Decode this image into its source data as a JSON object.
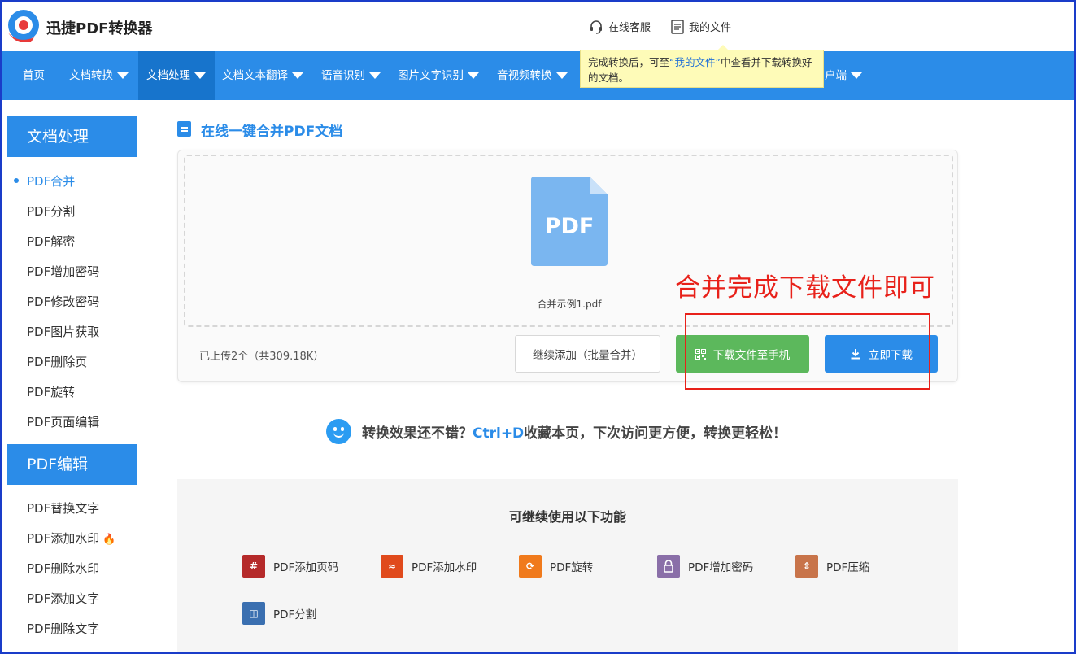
{
  "header": {
    "brand": "迅捷PDF转换器",
    "service_label": "在线客服",
    "files_label": "我的文件"
  },
  "nav": {
    "items": [
      {
        "label": "首页"
      },
      {
        "label": "文档转换"
      },
      {
        "label": "文档处理"
      },
      {
        "label": "文档文本翻译"
      },
      {
        "label": "语音识别"
      },
      {
        "label": "图片文字识别"
      },
      {
        "label": "音视频转换"
      },
      {
        "label": "户端"
      }
    ]
  },
  "tooltip": {
    "before": "完成转换后，可至",
    "link": "“我的文件”",
    "after": "中查看并下载转换好的文档。"
  },
  "sidebar": {
    "section1": "文档处理",
    "items1": [
      "PDF合并",
      "PDF分割",
      "PDF解密",
      "PDF增加密码",
      "PDF修改密码",
      "PDF图片获取",
      "PDF删除页",
      "PDF旋转",
      "PDF页面编辑"
    ],
    "section2": "PDF编辑",
    "items2": [
      "PDF替换文字",
      "PDF添加水印",
      "PDF删除水印",
      "PDF添加文字",
      "PDF删除文字"
    ]
  },
  "main": {
    "title": "在线一键合并PDF文档",
    "file_icon_label": "PDF",
    "file_name": "合并示例1.pdf",
    "upload_count": "已上传2个（共309.18K）",
    "continue_button": "继续添加（批量合并）",
    "phone_button": "下载文件至手机",
    "download_button": "立即下载"
  },
  "annotation": {
    "text": "合并完成下载文件即可"
  },
  "promo": {
    "prefix": "转换效果还不错？",
    "key": "Ctrl+D",
    "suffix": "收藏本页，下次访问更方便，转换更轻松！"
  },
  "more": {
    "title": "可继续使用以下功能",
    "tools": [
      {
        "label": "PDF添加页码",
        "icon": "page-number-icon",
        "color": "#b52a2a"
      },
      {
        "label": "PDF添加水印",
        "icon": "watermark-icon",
        "color": "#e04a1c"
      },
      {
        "label": "PDF旋转",
        "icon": "rotate-icon",
        "color": "#f07a1c"
      },
      {
        "label": "PDF增加密码",
        "icon": "lock-icon",
        "color": "#8a6fa8"
      },
      {
        "label": "PDF压缩",
        "icon": "compress-icon",
        "color": "#c8744a"
      },
      {
        "label": "PDF分割",
        "icon": "split-icon",
        "color": "#3a6fb0"
      }
    ]
  },
  "colors": {
    "primary": "#2b8ce8",
    "green": "#5cb85c",
    "annotation": "#e8211a",
    "tooltip_bg": "#fefbb8"
  }
}
